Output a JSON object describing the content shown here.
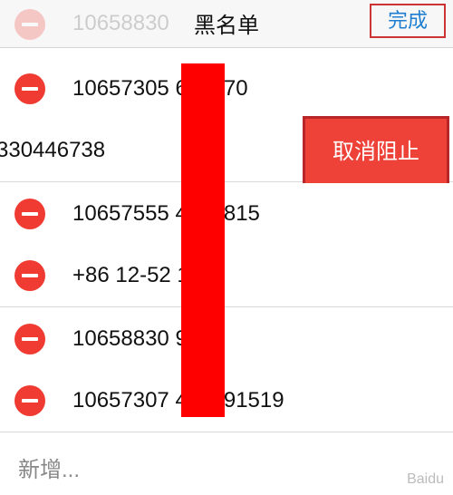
{
  "nav": {
    "title": "黑名单",
    "done_label": "完成"
  },
  "ghost_item": "10658830",
  "items": [
    {
      "number": "10657305 650970"
    },
    {
      "number": "330446738"
    },
    {
      "number": "10657555 4127815"
    },
    {
      "number": "+86 12-52 107"
    },
    {
      "number": "10658830 954"
    },
    {
      "number": "10657307 461591519"
    }
  ],
  "unblock_label": "取消阻止",
  "add_label": "新增...",
  "watermark": "Baidu"
}
